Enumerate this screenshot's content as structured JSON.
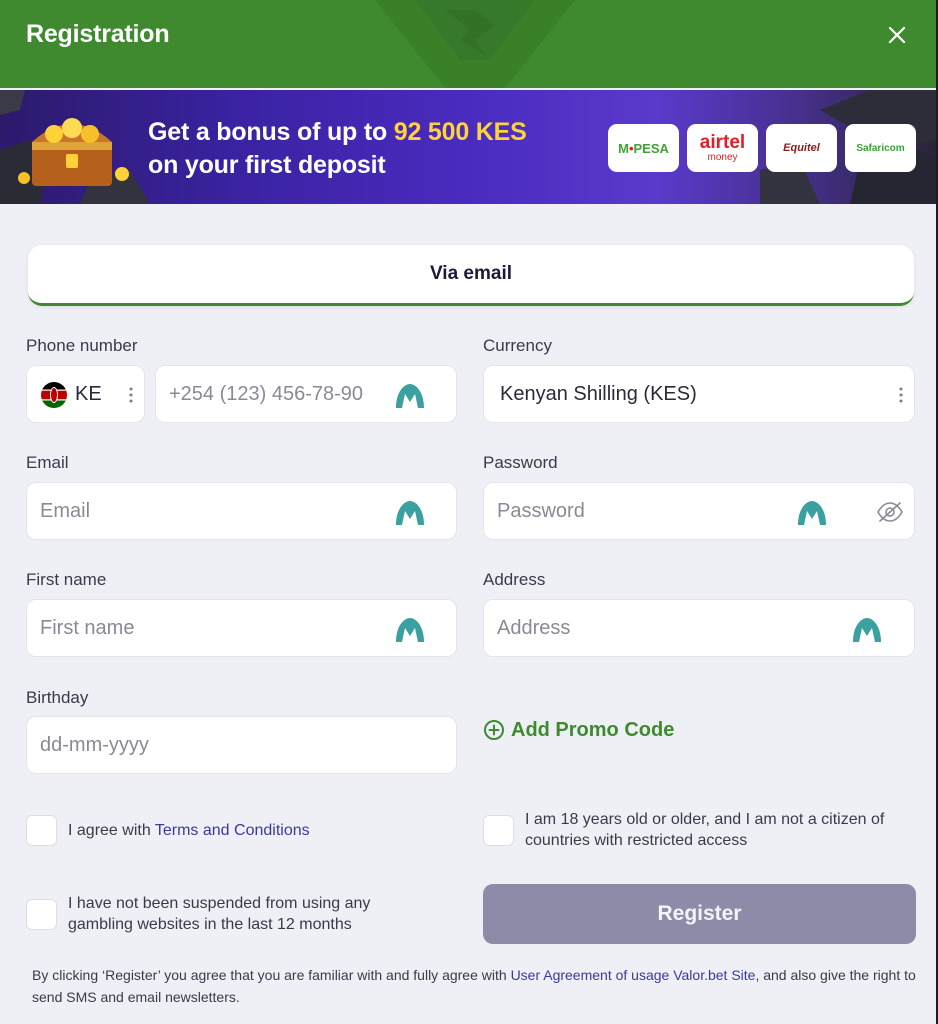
{
  "header": {
    "title": "Registration"
  },
  "banner": {
    "line1_prefix": "Get a bonus of up to ",
    "line1_highlight": "92 500 KES",
    "line2": "on your first deposit",
    "payment_logos": [
      {
        "name": "mpesa",
        "text_a": "M",
        "text_b": "PESA"
      },
      {
        "name": "airtel",
        "text": "airtel",
        "sub": "money"
      },
      {
        "name": "equitel",
        "text": "Equitel"
      },
      {
        "name": "safaricom",
        "text": "Safaricom"
      }
    ],
    "highlight_color": "#ffd23a"
  },
  "tab": {
    "label": "Via email"
  },
  "form": {
    "phone": {
      "label": "Phone number",
      "country_code": "KE",
      "placeholder": "+254 (123) 456-78-90"
    },
    "currency": {
      "label": "Currency",
      "value": "Kenyan Shilling (KES)"
    },
    "email": {
      "label": "Email",
      "placeholder": "Email"
    },
    "password": {
      "label": "Password",
      "placeholder": "Password"
    },
    "first_name": {
      "label": "First name",
      "placeholder": "First name"
    },
    "address": {
      "label": "Address",
      "placeholder": "Address"
    },
    "birthday": {
      "label": "Birthday",
      "placeholder": "dd-mm-yyyy"
    },
    "promo": {
      "label": "Add Promo Code"
    }
  },
  "checkboxes": {
    "terms": {
      "prefix": "I agree with ",
      "link": "Terms and Conditions",
      "checked": false
    },
    "age": {
      "line1": "I am 18 years old or older, and I am not a citizen of",
      "line2": "countries with restricted access",
      "checked": false
    },
    "suspended": {
      "line1": "I have not been suspended from using any",
      "line2": "gambling websites in the last 12 months",
      "checked": false
    }
  },
  "register_button": {
    "label": "Register"
  },
  "footer": {
    "prefix": "By clicking ‘Register’ you agree that you are familiar with and fully agree with ",
    "link": "User Agreement of usage Valor.bet Site",
    "suffix": ", and also give the right to send SMS and email newsletters."
  },
  "colors": {
    "brand_green": "#3f8a2f",
    "ghost_icon": "#3aa0a0",
    "link": "#3a3a9e",
    "button_disabled": "#8c8ca8"
  }
}
